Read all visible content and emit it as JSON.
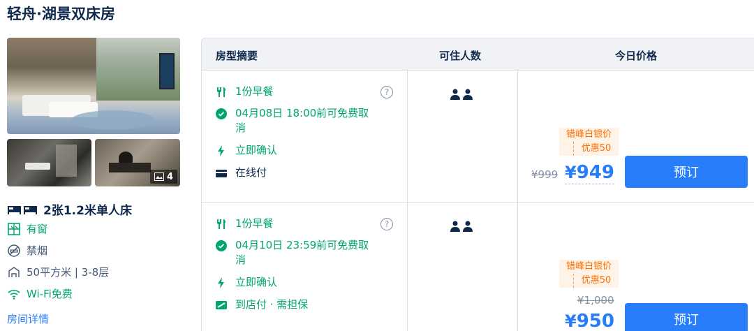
{
  "room": {
    "title": "轻舟·湖景双床房",
    "photo_count": "4",
    "features": {
      "bed": "2张1.2米单人床",
      "window": "有窗",
      "smoking": "禁烟",
      "area_floor": "50平方米 | 3-8层",
      "wifi": "Wi-Fi免费"
    },
    "detail_link": "房间详情"
  },
  "table": {
    "headers": {
      "summary": "房型摘要",
      "guests": "可住人数",
      "price": "今日价格"
    },
    "rows": [
      {
        "breakfast": "1份早餐",
        "cancel": "04月08日 18:00前可免费取消",
        "cancel_line1": "04月08日 18:00前可免费取",
        "cancel_line2": "消",
        "confirm": "立即确认",
        "payment": "在线付",
        "promo_title": "错峰白银价",
        "promo_sub": "优惠50",
        "original_price": "¥999",
        "price": "949",
        "currency": "¥",
        "book_label": "预订"
      },
      {
        "breakfast": "1份早餐",
        "cancel": "04月10日 23:59前可免费取消",
        "cancel_line1": "04月10日 23:59前可免费取",
        "cancel_line2": "消",
        "confirm": "立即确认",
        "payment": "到店付 · 需担保",
        "promo_title": "错峰白银价",
        "promo_sub": "优惠50",
        "original_price": "¥1,000",
        "price": "950",
        "currency": "¥",
        "book_label": "预订"
      }
    ]
  },
  "colors": {
    "accent": "#287dfa",
    "green": "#00a66c",
    "promo": "#ff6f00",
    "header_bg": "#f0f2f5"
  }
}
